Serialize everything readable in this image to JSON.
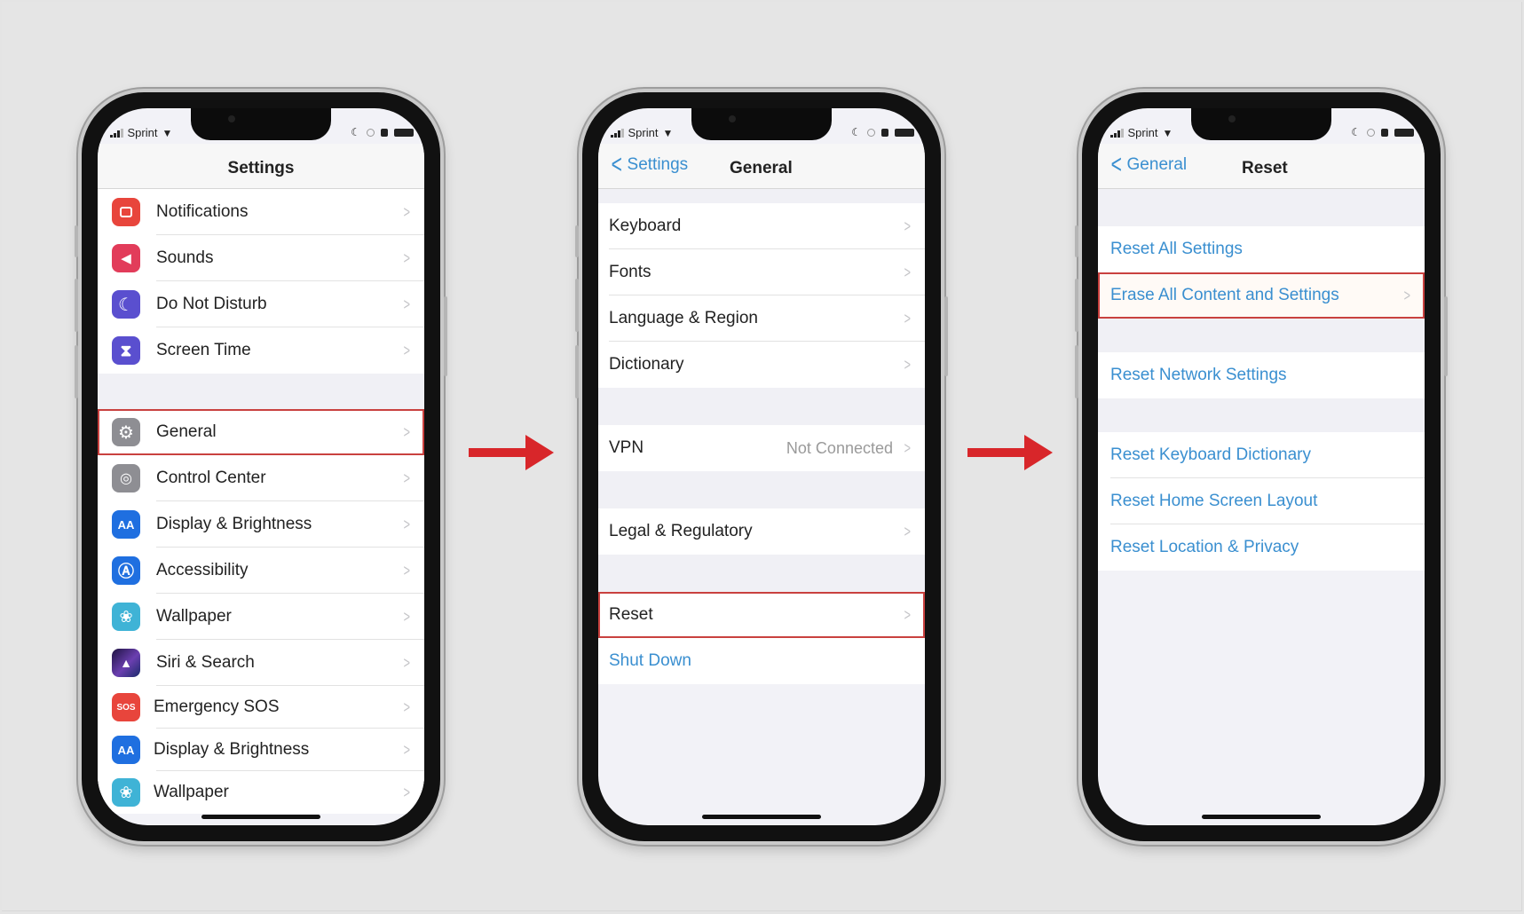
{
  "colors": {
    "highlight": "#c9413f",
    "link_blue": "#3a8fd0",
    "arrow_red": "#d8262a",
    "background": "#e5e5e5"
  },
  "status_bar": {
    "carrier": "Sprint",
    "icons": [
      "signal-icon",
      "wifi-icon",
      "moon-icon",
      "orientation-lock-icon",
      "alarm-icon",
      "battery-icon"
    ]
  },
  "arrows": [
    "right-arrow-icon",
    "right-arrow-icon"
  ],
  "phone1": {
    "title": "Settings",
    "group1": [
      {
        "label": "Notifications",
        "icon": "notifications-icon",
        "color": "#e8453c"
      },
      {
        "label": "Sounds",
        "icon": "speaker-icon",
        "color": "#e23c5a"
      },
      {
        "label": "Do Not Disturb",
        "icon": "moon-icon",
        "color": "#5a4fcf"
      },
      {
        "label": "Screen Time",
        "icon": "hourglass-icon",
        "color": "#5a4fcf"
      }
    ],
    "group2": [
      {
        "label": "General",
        "icon": "gear-icon",
        "color": "#8e8e93",
        "highlighted": true
      },
      {
        "label": "Control Center",
        "icon": "toggles-icon",
        "color": "#8e8e93"
      },
      {
        "label": "Display & Brightness",
        "icon": "text-size-icon",
        "color": "#1f6fe0",
        "glyph": "AA"
      },
      {
        "label": "Accessibility",
        "icon": "accessibility-icon",
        "color": "#1f6fe0"
      },
      {
        "label": "Wallpaper",
        "icon": "flower-icon",
        "color": "#3fb3d6"
      },
      {
        "label": "Siri & Search",
        "icon": "siri-icon",
        "color": "#3a2a6e"
      },
      {
        "label": "Emergency SOS",
        "icon": "sos-icon",
        "color": "#e8453c",
        "glyph": "SOS"
      },
      {
        "label": "Display & Brightness",
        "icon": "text-size-icon",
        "color": "#1f6fe0",
        "glyph": "AA"
      },
      {
        "label": "Wallpaper",
        "icon": "flower-icon",
        "color": "#3fb3d6"
      }
    ]
  },
  "phone2": {
    "back_label": "Settings",
    "title": "General",
    "group1": [
      {
        "label": "Keyboard"
      },
      {
        "label": "Fonts"
      },
      {
        "label": "Language & Region"
      },
      {
        "label": "Dictionary"
      }
    ],
    "vpn": {
      "label": "VPN",
      "value": "Not Connected"
    },
    "legal": {
      "label": "Legal & Regulatory"
    },
    "reset": {
      "label": "Reset",
      "highlighted": true
    },
    "shutdown": {
      "label": "Shut Down"
    }
  },
  "phone3": {
    "back_label": "General",
    "title": "Reset",
    "group1": [
      {
        "label": "Reset All Settings"
      },
      {
        "label": "Erase All Content and Settings",
        "highlighted": true
      }
    ],
    "group2": [
      {
        "label": "Reset Network Settings"
      }
    ],
    "group3": [
      {
        "label": "Reset Keyboard Dictionary"
      },
      {
        "label": "Reset Home Screen Layout"
      },
      {
        "label": "Reset Location & Privacy"
      }
    ]
  }
}
